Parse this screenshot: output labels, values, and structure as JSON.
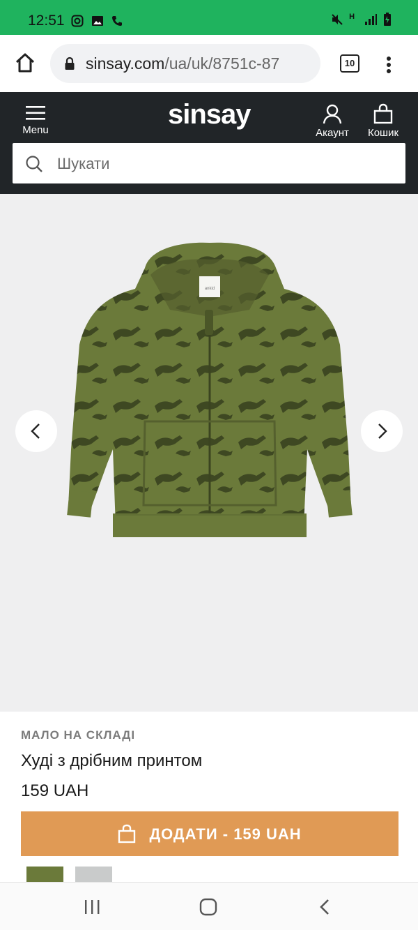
{
  "status_bar": {
    "time": "12:51",
    "left_icons": [
      "instagram-icon",
      "image-icon",
      "phone-icon"
    ],
    "right_icons": [
      "mute-icon",
      "data-icon",
      "signal-icon",
      "battery-icon"
    ],
    "data_label": "H"
  },
  "browser": {
    "url_host": "sinsay.com",
    "url_path": "/ua/uk/8751c-87",
    "tab_count": "10"
  },
  "header": {
    "logo": "sinsay",
    "menu_label": "Menu",
    "account_label": "Акаунт",
    "cart_label": "Кошик",
    "search_placeholder": "Шукати"
  },
  "product": {
    "stock_status": "МАЛО НА СКЛАДІ",
    "title": "Худі з дрібним принтом",
    "price": "159 UAH",
    "add_to_cart_label": "ДОДАТИ - 159 UAH",
    "image_label": "ankid",
    "swatch_colors": [
      "#6b7a3a",
      "#c9cbcb"
    ]
  },
  "colors": {
    "status_bar": "#1fb35e",
    "header_bg": "#212528",
    "cta": "#e09a55"
  }
}
